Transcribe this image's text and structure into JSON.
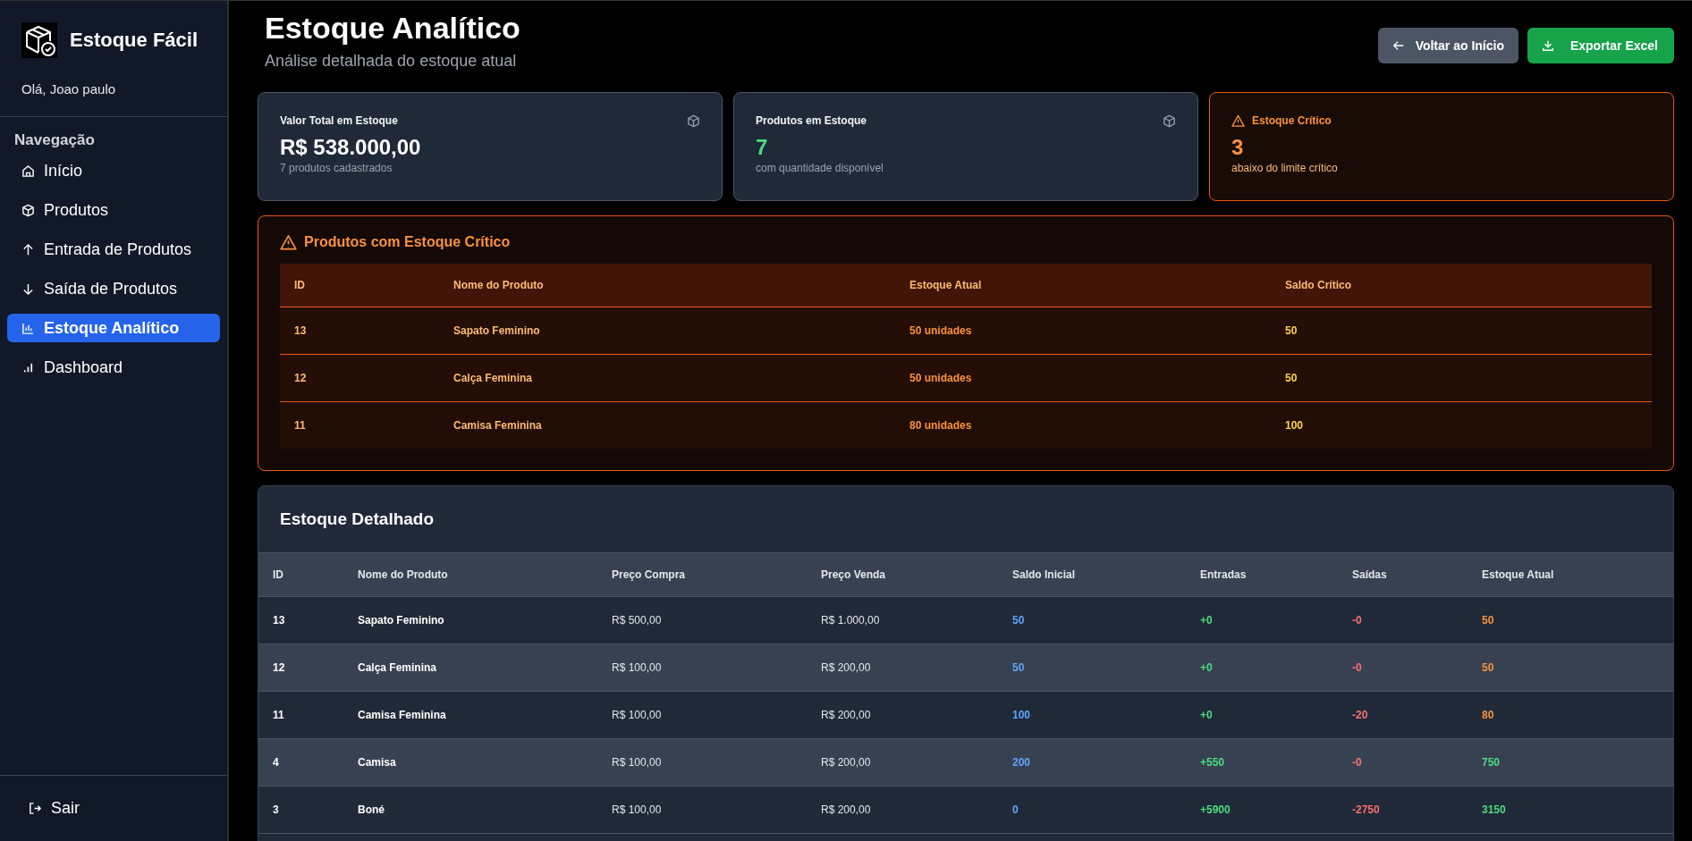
{
  "sidebar": {
    "brand": "Estoque Fácil",
    "greeting": "Olá, Joao paulo",
    "section_title": "Navegação",
    "items": [
      {
        "label": "Início",
        "selected": false
      },
      {
        "label": "Produtos",
        "selected": false
      },
      {
        "label": "Entrada de Produtos",
        "selected": false
      },
      {
        "label": "Saída de Produtos",
        "selected": false
      },
      {
        "label": "Estoque Analítico",
        "selected": true
      },
      {
        "label": "Dashboard",
        "selected": false
      }
    ],
    "logout": "Sair"
  },
  "header": {
    "title": "Estoque Analítico",
    "subtitle": "Análise detalhada do estoque atual",
    "buttons": [
      {
        "kind": "back",
        "label": "Voltar ao Início"
      },
      {
        "kind": "export",
        "label": "Exportar Excel"
      }
    ]
  },
  "cards": [
    {
      "kind": "value",
      "title": "Valor Total em Estoque",
      "value": "R$ 538.000,00",
      "caption": "7 produtos cadastrados"
    },
    {
      "kind": "count",
      "title": "Produtos em Estoque",
      "value": "7",
      "caption": "com quantidade disponível"
    },
    {
      "kind": "critical",
      "title": "Estoque Crítico",
      "value": "3",
      "caption": "abaixo do limite crítico"
    }
  ],
  "critical_panel": {
    "title": "Produtos com Estoque Crítico",
    "columns": [
      "ID",
      "Nome do Produto",
      "Estoque Atual",
      "Saldo Crítico"
    ],
    "rows": [
      [
        "13",
        "Sapato Feminino",
        "50 unidades",
        "50"
      ],
      [
        "12",
        "Calça Feminina",
        "50 unidades",
        "50"
      ],
      [
        "11",
        "Camisa Feminina",
        "80 unidades",
        "100"
      ]
    ]
  },
  "detail_panel": {
    "title": "Estoque Detalhado",
    "columns": [
      "ID",
      "Nome do Produto",
      "Preço Compra",
      "Preço Venda",
      "Saldo Inicial",
      "Entradas",
      "Saídas",
      "Estoque Atual"
    ],
    "rows": [
      {
        "critical": true,
        "cells": [
          "13",
          "Sapato Feminino",
          "R$ 500,00",
          "R$ 1.000,00",
          "50",
          "+0",
          "-0",
          "50"
        ]
      },
      {
        "critical": true,
        "cells": [
          "12",
          "Calça Feminina",
          "R$ 100,00",
          "R$ 200,00",
          "50",
          "+0",
          "-0",
          "50"
        ]
      },
      {
        "critical": true,
        "cells": [
          "11",
          "Camisa Feminina",
          "R$ 100,00",
          "R$ 200,00",
          "100",
          "+0",
          "-20",
          "80"
        ]
      },
      {
        "critical": false,
        "cells": [
          "4",
          "Camisa",
          "R$ 100,00",
          "R$ 200,00",
          "200",
          "+550",
          "-0",
          "750"
        ]
      },
      {
        "critical": false,
        "cells": [
          "3",
          "Boné",
          "R$ 100,00",
          "R$ 200,00",
          "0",
          "+5900",
          "-2750",
          "3150"
        ]
      }
    ]
  }
}
